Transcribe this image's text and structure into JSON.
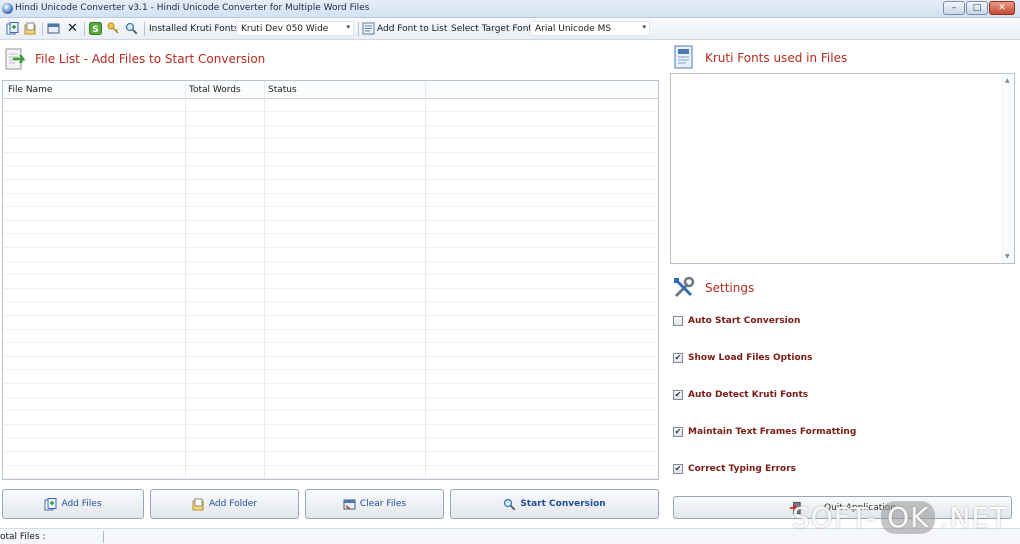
{
  "window": {
    "title": "Hindi Unicode Converter v3.1 - Hindi Unicode Converter for Multiple Word Files",
    "minimize": "–",
    "maximize": "□",
    "close": "✕"
  },
  "toolbar": {
    "installed_label": "Installed Kruti Fonts",
    "installed_value": "Kruti Dev 050 Wide",
    "add_font_label": "Add Font to List",
    "target_label": "Select Target Font",
    "target_value": "Arial Unicode MS",
    "dropdown_arrow": "▾"
  },
  "file_list": {
    "title": "File List - Add Files to Start Conversion",
    "columns": [
      "File Name",
      "Total Words",
      "Status"
    ],
    "rows": []
  },
  "fonts_panel": {
    "title": "Kruti Fonts used in Files",
    "scroll_up": "▲",
    "scroll_down": "▼"
  },
  "settings": {
    "title": "Settings",
    "options": [
      {
        "label": "Auto Start Conversion",
        "checked": false
      },
      {
        "label": "Show Load Files Options",
        "checked": true
      },
      {
        "label": "Auto Detect Kruti Fonts",
        "checked": true
      },
      {
        "label": "Maintain Text Frames Formatting",
        "checked": true
      },
      {
        "label": "Correct Typing Errors",
        "checked": true
      }
    ]
  },
  "buttons": {
    "add_files": "Add Files",
    "add_folder": "Add Folder",
    "clear_files": "Clear Files",
    "start_conversion": "Start Conversion",
    "quit": "Quit Application"
  },
  "status": {
    "total_files": "otal Files :"
  },
  "watermark": {
    "part1": "SOFT-",
    "part2": "OK",
    "part3": ".NET"
  },
  "colors": {
    "accent_red": "#b52a1f",
    "label_dark_red": "#7a1b14",
    "button_text_blue": "#1f4f9e"
  }
}
